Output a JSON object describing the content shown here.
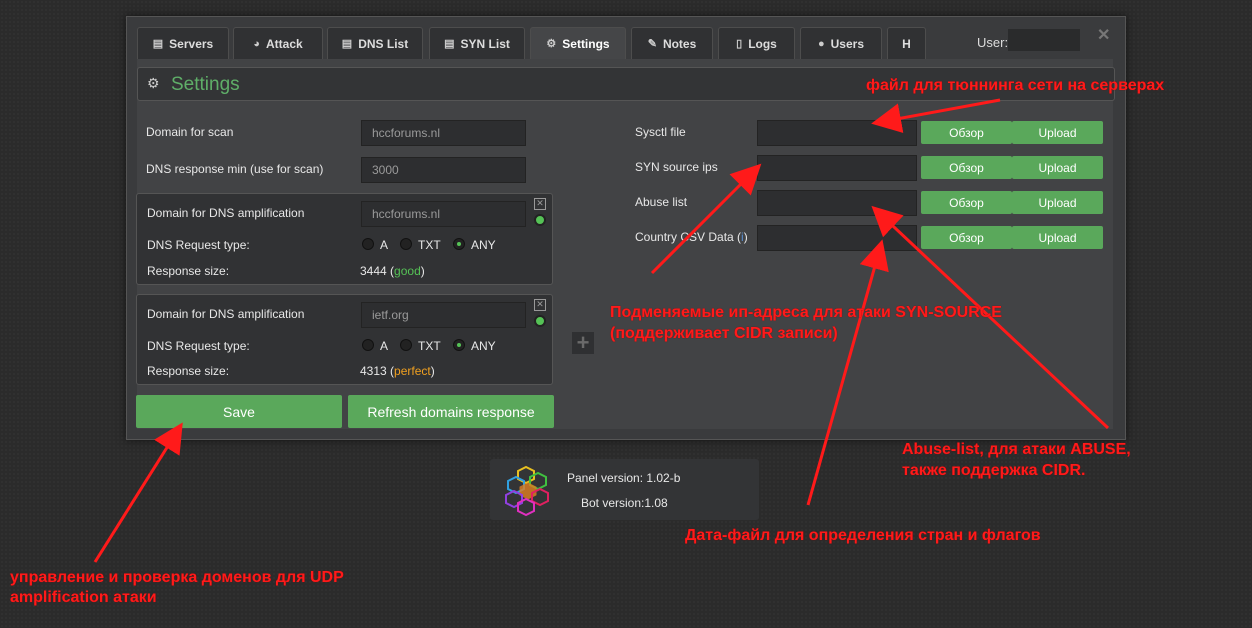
{
  "tabs": [
    {
      "label": "Servers",
      "icon": "server-icon",
      "glyph": "▤"
    },
    {
      "label": "Attack",
      "icon": "dashboard-icon",
      "glyph": "◕"
    },
    {
      "label": "DNS List",
      "icon": "list-icon",
      "glyph": "▤"
    },
    {
      "label": "SYN List",
      "icon": "list-icon",
      "glyph": "▤"
    },
    {
      "label": "Settings",
      "icon": "gears-icon",
      "glyph": "⚙"
    },
    {
      "label": "Notes",
      "icon": "edit-icon",
      "glyph": "✎"
    },
    {
      "label": "Logs",
      "icon": "file-icon",
      "glyph": "▯"
    },
    {
      "label": "Users",
      "icon": "user-icon",
      "glyph": "●"
    },
    {
      "label": "H",
      "icon": "",
      "glyph": ""
    }
  ],
  "user_label": "User:",
  "close_glyph": "✕",
  "title": "Settings",
  "scan": {
    "domain_label": "Domain for scan",
    "domain_value": "hccforums.nl",
    "min_label": "DNS response min (use for scan)",
    "min_value": "3000"
  },
  "dns_entries": [
    {
      "label": "Domain for DNS amplification",
      "value": "hccforums.nl",
      "type_label": "DNS Request type:",
      "opt_a": "A",
      "opt_txt": "TXT",
      "opt_any": "ANY",
      "size_label": "Response size:",
      "size_value": "3444",
      "quality": "good",
      "quality_color": "#55c256"
    },
    {
      "label": "Domain for DNS amplification",
      "value": "ietf.org",
      "type_label": "DNS Request type:",
      "opt_a": "A",
      "opt_txt": "TXT",
      "opt_any": "ANY",
      "size_label": "Response size:",
      "size_value": "4313",
      "quality": "perfect",
      "quality_color": "#f0a020"
    }
  ],
  "buttons": {
    "save": "Save",
    "refresh": "Refresh domains response",
    "plus": "+"
  },
  "files": [
    {
      "label": "Sysctl file",
      "browse": "Обзор",
      "upload": "Upload"
    },
    {
      "label": "SYN source ips",
      "browse": "Обзор",
      "upload": "Upload"
    },
    {
      "label": "Abuse list",
      "browse": "Обзор",
      "upload": "Upload"
    },
    {
      "label": "Country CSV Data (",
      "label_end": ")",
      "info_glyph": "i",
      "browse": "Обзор",
      "upload": "Upload"
    }
  ],
  "version": {
    "panel": "Panel version: 1.02-b",
    "bot": "Bot version:1.08"
  },
  "annotations": {
    "sysctl": "файл для тюннинга сети на серверах",
    "syn_line1": "Подменяемые ип-адреса для атаки SYN-SOURCE",
    "syn_line2": "(поддерживает CIDR записи)",
    "abuse_line1": "Abuse-list, для атаки ABUSE,",
    "abuse_line2": "также поддержка CIDR.",
    "data": "Дата-файл для определения стран и флагов",
    "udp_line1": "управление и проверка доменов для UDP",
    "udp_line2": "amplification атаки"
  },
  "colors": {
    "accent": "#5aa85b",
    "annotation": "#ff1a1a",
    "title": "#5fae68"
  }
}
